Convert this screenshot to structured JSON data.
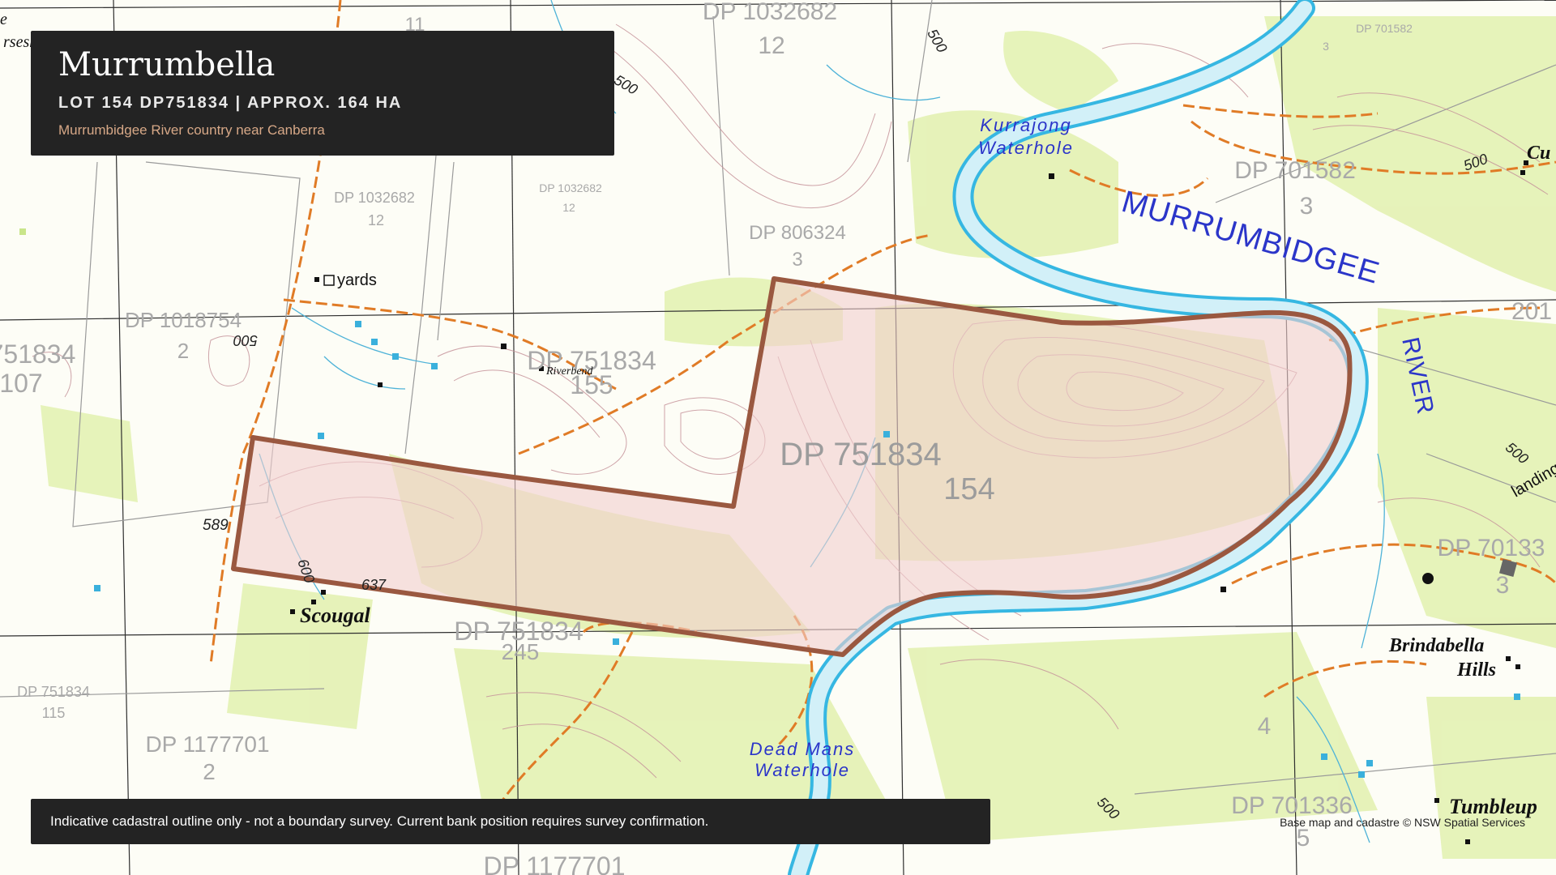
{
  "header": {
    "title": "Murrumbella",
    "subtitle": "LOT 154 DP751834 | APPROX. 164 HA",
    "tagline": "Murrumbidgee River country near Canberra"
  },
  "footer": {
    "disclaimer": "Indicative cadastral outline only - not a boundary survey. Current bank position requires survey confirmation.",
    "credit": "Base map and cadastre © NSW Spatial Services"
  },
  "map": {
    "river": "MURRUMBIDGEE",
    "river_word": "RIVER",
    "waterholes": [
      {
        "line1": "Kurrajong",
        "line2": "Waterhole"
      },
      {
        "line1": "Dead Mans",
        "line2": "Waterhole"
      }
    ],
    "places": [
      "yards",
      "Riverbend",
      "Scougal",
      "Brindabella",
      "Hills",
      "Tumbleup",
      "landing",
      "Cu",
      "rseshoe",
      "e"
    ],
    "parcels": [
      {
        "dp": "DP 1032682",
        "lot": "12"
      },
      {
        "dp": "DP 1032682",
        "lot": "12"
      },
      {
        "dp": "DP 1032682",
        "lot": "12"
      },
      {
        "dp": "DP 1032682",
        "lot": "11"
      },
      {
        "dp": "DP 806324",
        "lot": "3"
      },
      {
        "dp": "DP 701582",
        "lot": "3"
      },
      {
        "dp": "DP 701582",
        "lot": "3"
      },
      {
        "dp": "DP 1018754",
        "lot": "2"
      },
      {
        "dp": "DP 751834",
        "lot": "155"
      },
      {
        "dp": "DP 751834",
        "lot": "154"
      },
      {
        "dp": "DP 751834",
        "lot": "245"
      },
      {
        "dp": "DP 751834",
        "lot": "115"
      },
      {
        "dp": "751834",
        "lot": "107"
      },
      {
        "dp": "DP 1177701",
        "lot": "2"
      },
      {
        "dp": "DP 701336",
        "lot": "5"
      },
      {
        "dp": "DP 70133",
        "lot": "3"
      },
      {
        "dp": "201",
        "lot": ""
      },
      {
        "dp": "",
        "lot": "4"
      },
      {
        "dp": "DP 1177701",
        "lot": ""
      }
    ],
    "spot_heights": [
      "589",
      "600",
      "637",
      "500",
      "500",
      "500",
      "500",
      "500",
      "500"
    ],
    "colors": {
      "boundary": "#9a5840",
      "lot_fill": "#f2cfcf",
      "river": "#36b7e2",
      "river_fill": "#c8ecf5",
      "vegetation": "#e6f2b8",
      "track": "#e07b26",
      "contour": "#c79aa0",
      "grid": "#333333"
    }
  }
}
